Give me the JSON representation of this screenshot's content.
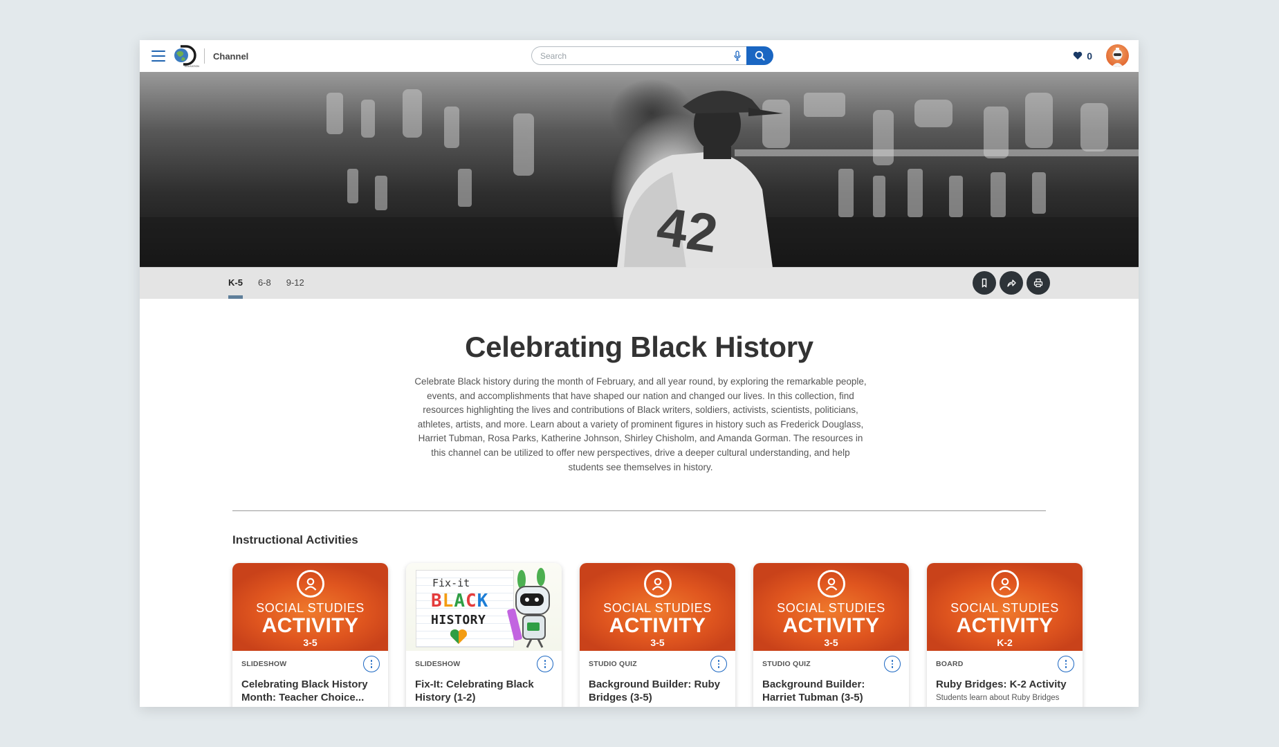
{
  "header": {
    "logo_text": "EDUCATION",
    "channel_label": "Channel",
    "search_placeholder": "Search",
    "favorites_count": "0"
  },
  "hero": {
    "jersey_number": "42"
  },
  "grade_tabs": [
    {
      "label": "K-5",
      "active": true
    },
    {
      "label": "6-8",
      "active": false
    },
    {
      "label": "9-12",
      "active": false
    }
  ],
  "actions": [
    "bookmark-icon",
    "share-icon",
    "print-icon"
  ],
  "page": {
    "title": "Celebrating Black History",
    "description": "Celebrate Black history during the month of February, and all year round, by exploring the remarkable people, events, and accomplishments that have shaped our nation and changed our lives. In this collection, find resources highlighting the lives and contributions of Black writers, soldiers, activists, scientists, politicians, athletes, artists, and more. Learn about a variety of prominent figures in history such as Frederick Douglass, Harriet Tubman, Rosa Parks, Katherine Johnson, Shirley Chisholm, and Amanda Gorman. The resources in this channel can be utilized to offer new perspectives, drive a deeper cultural understanding, and help students see themselves in history."
  },
  "section": {
    "title": "Instructional Activities"
  },
  "cards": [
    {
      "thumb": "activity",
      "subject": "SOCIAL STUDIES",
      "kind": "ACTIVITY",
      "grade": "3-5",
      "type": "SLIDESHOW",
      "title": "Celebrating Black History Month: Teacher Choice...",
      "desc": ""
    },
    {
      "thumb": "fixit",
      "fix_line1": "Fix-it",
      "fix_line2": [
        "B",
        "L",
        "A",
        "C",
        "K"
      ],
      "fix_line3": "HISTORY",
      "type": "SLIDESHOW",
      "title": "Fix-It: Celebrating Black History (1-2)",
      "desc": ""
    },
    {
      "thumb": "activity",
      "subject": "SOCIAL STUDIES",
      "kind": "ACTIVITY",
      "grade": "3-5",
      "type": "STUDIO QUIZ",
      "title": "Background Builder: Ruby Bridges (3-5)",
      "desc": ""
    },
    {
      "thumb": "activity",
      "subject": "SOCIAL STUDIES",
      "kind": "ACTIVITY",
      "grade": "3-5",
      "type": "STUDIO QUIZ",
      "title": "Background Builder: Harriet Tubman (3-5)",
      "desc": ""
    },
    {
      "thumb": "activity",
      "subject": "SOCIAL STUDIES",
      "kind": "ACTIVITY",
      "grade": "K-2",
      "type": "BOARD",
      "title": "Ruby Bridges: K-2 Activity",
      "desc": "Students learn about Ruby Bridges"
    }
  ],
  "colors": {
    "accent": "#1a66c2",
    "activity_orange": "#e0561f",
    "tab_underline": "#5f7f9a"
  }
}
